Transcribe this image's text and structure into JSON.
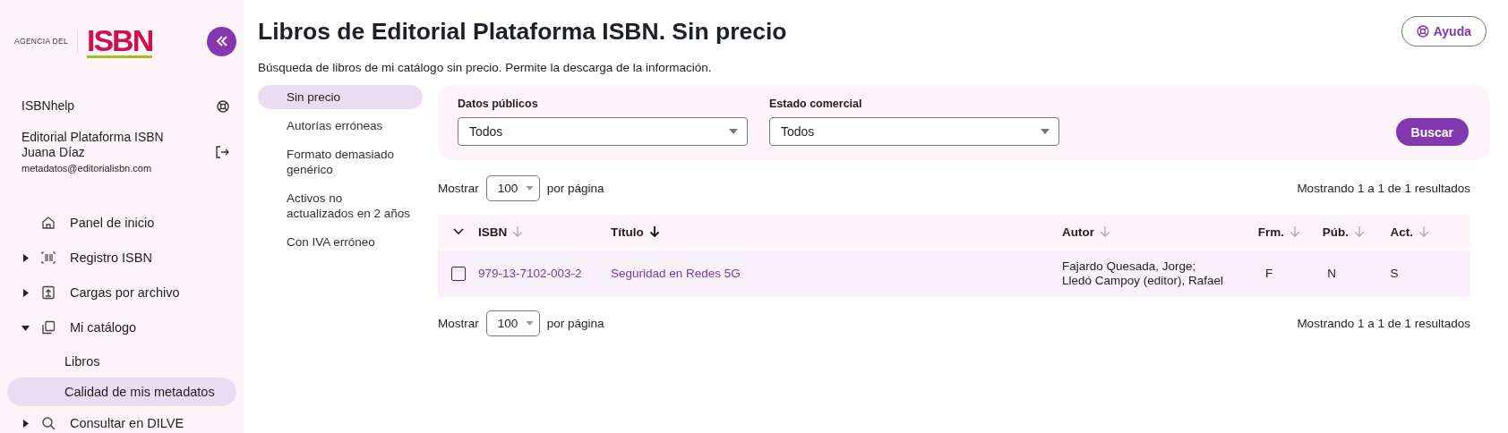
{
  "sidebar": {
    "logo": {
      "prefix": "AGENCIA DEL",
      "mark": "ISBN"
    },
    "help": {
      "label": "ISBNhelp"
    },
    "user": {
      "publisher": "Editorial Plataforma ISBN",
      "name": "Juana Díaz",
      "email": "metadatos@editorialisbn.com"
    },
    "items": [
      {
        "label": "Panel de inicio",
        "kind": "link",
        "selected": false
      },
      {
        "label": "Registro ISBN",
        "kind": "group",
        "expanded": false,
        "selected": false
      },
      {
        "label": "Cargas por archivo",
        "kind": "group",
        "expanded": false,
        "selected": false
      },
      {
        "label": "Mi catálogo",
        "kind": "group",
        "expanded": true,
        "selected": false,
        "children": [
          {
            "label": "Libros",
            "selected": false
          },
          {
            "label": "Calidad de mis metadatos",
            "selected": true
          }
        ]
      },
      {
        "label": "Consultar en DILVE",
        "kind": "group",
        "expanded": false,
        "selected": false
      }
    ]
  },
  "page": {
    "title": "Libros de Editorial Plataforma ISBN. Sin precio",
    "help_button": "Ayuda",
    "description": "Búsqueda de libros de mi catálogo sin precio. Permite la descarga de la información."
  },
  "subnav": [
    {
      "label": "Sin precio",
      "selected": true
    },
    {
      "label": "Autorías erróneas",
      "selected": false
    },
    {
      "label": "Formato demasiado genérico",
      "selected": false
    },
    {
      "label": "Activos no actualizados en 2 años",
      "selected": false
    },
    {
      "label": "Con IVA erróneo",
      "selected": false
    }
  ],
  "filters": {
    "fields": [
      {
        "label": "Datos públicos",
        "value": "Todos"
      },
      {
        "label": "Estado comercial",
        "value": "Todos"
      }
    ],
    "search_button": "Buscar"
  },
  "pagers": [
    {
      "show_label": "Mostrar",
      "per_page": "100",
      "per_page_label": "por página",
      "results": "Mostrando 1 a 1 de 1 resultados"
    },
    {
      "show_label": "Mostrar",
      "per_page": "100",
      "per_page_label": "por página",
      "results": "Mostrando 1 a 1 de 1 resultados"
    }
  ],
  "table": {
    "columns": [
      {
        "label": "ISBN",
        "sorted": false
      },
      {
        "label": "Título",
        "sorted": true
      },
      {
        "label": "Autor",
        "sorted": false
      },
      {
        "label": "Frm.",
        "sorted": false
      },
      {
        "label": "Púb.",
        "sorted": false
      },
      {
        "label": "Act.",
        "sorted": false
      }
    ],
    "rows": [
      {
        "checked": false,
        "cells": [
          "979-13-7102-003-2",
          "Seguridad en Redes 5G",
          "Fajardo Quesada, Jorge;\nLledó Campoy (editor), Rafael",
          "F",
          "N",
          "S"
        ]
      }
    ]
  }
}
